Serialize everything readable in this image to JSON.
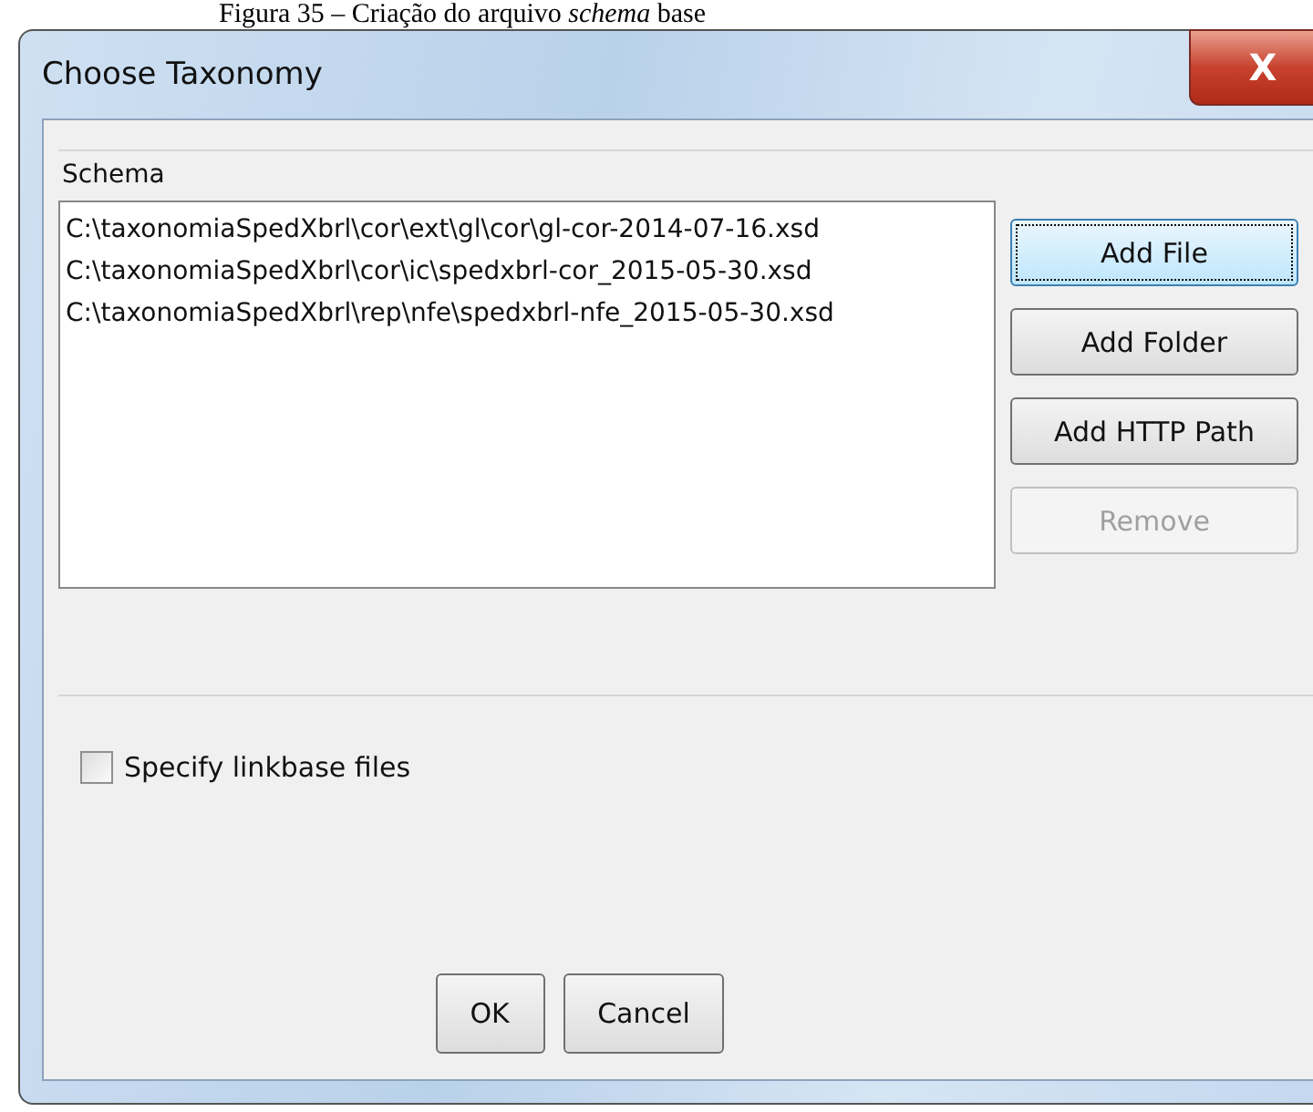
{
  "caption": "Figura 35 – Criação do arquivo *schema* base",
  "window": {
    "title": "Choose Taxonomy",
    "close": "X"
  },
  "schema": {
    "label": "Schema",
    "files": [
      {
        "path": "C:\\taxonomiaSpedXbrl\\cor\\ext\\gl\\cor\\gl-cor-2014-07-16.xsd"
      },
      {
        "path": "C:\\taxonomiaSpedXbrl\\cor\\ic\\spedxbrl-cor_2015-05-30.xsd"
      },
      {
        "path": "C:\\taxonomiaSpedXbrl\\rep\\nfe\\spedxbrl-nfe_2015-05-30.xsd"
      }
    ],
    "buttons": [
      {
        "label": "Add File",
        "focused": true,
        "disabled": false
      },
      {
        "label": "Add Folder",
        "focused": false,
        "disabled": false
      },
      {
        "label": "Add HTTP Path",
        "focused": false,
        "disabled": false
      },
      {
        "label": "Remove",
        "focused": false,
        "disabled": true
      }
    ]
  },
  "linkbase": {
    "label": "Specify linkbase files",
    "checked": false
  },
  "buttons": [
    "OK",
    "Cancel"
  ]
}
